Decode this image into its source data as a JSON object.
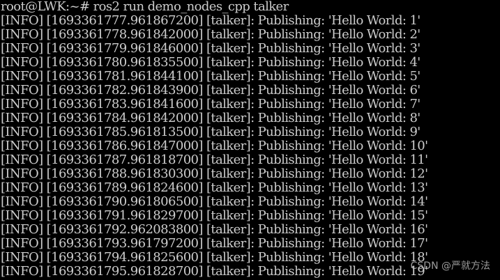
{
  "terminal": {
    "lines": [
      "root@LWK:~# ros2 run demo_nodes_cpp talker",
      "[INFO] [1693361777.961867200] [talker]: Publishing: 'Hello World: 1'",
      "[INFO] [1693361778.961842000] [talker]: Publishing: 'Hello World: 2'",
      "[INFO] [1693361779.961846000] [talker]: Publishing: 'Hello World: 3'",
      "[INFO] [1693361780.961835500] [talker]: Publishing: 'Hello World: 4'",
      "[INFO] [1693361781.961844100] [talker]: Publishing: 'Hello World: 5'",
      "[INFO] [1693361782.961843900] [talker]: Publishing: 'Hello World: 6'",
      "[INFO] [1693361783.961841600] [talker]: Publishing: 'Hello World: 7'",
      "[INFO] [1693361784.961842000] [talker]: Publishing: 'Hello World: 8'",
      "[INFO] [1693361785.961813500] [talker]: Publishing: 'Hello World: 9'",
      "[INFO] [1693361786.961847000] [talker]: Publishing: 'Hello World: 10'",
      "[INFO] [1693361787.961818700] [talker]: Publishing: 'Hello World: 11'",
      "[INFO] [1693361788.961830300] [talker]: Publishing: 'Hello World: 12'",
      "[INFO] [1693361789.961824600] [talker]: Publishing: 'Hello World: 13'",
      "[INFO] [1693361790.961806500] [talker]: Publishing: 'Hello World: 14'",
      "[INFO] [1693361791.961829700] [talker]: Publishing: 'Hello World: 15'",
      "[INFO] [1693361792.962083800] [talker]: Publishing: 'Hello World: 16'",
      "[INFO] [1693361793.961797200] [talker]: Publishing: 'Hello World: 17'",
      "[INFO] [1693361794.961825600] [talker]: Publishing: 'Hello World: 18'",
      "[INFO] [1693361795.961828700] [talker]: Publishing: 'Hello World: 19'"
    ]
  },
  "watermark": {
    "text": "CSDN @严就方法"
  }
}
